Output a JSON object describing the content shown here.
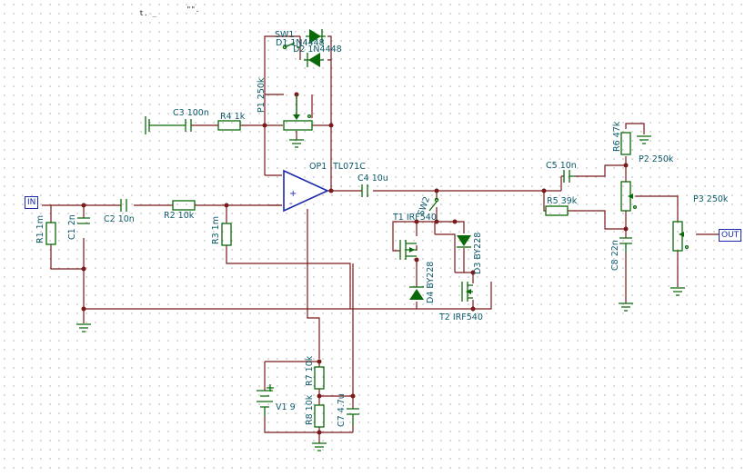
{
  "header": {
    "left": "t. _",
    "right": "\"\"."
  },
  "ports": {
    "input": "IN",
    "output": "OUT"
  },
  "labels": {
    "sw1": "SW1",
    "d1": "D1 1N4448",
    "d2": "D2 1N4448",
    "p1": "P1 250k",
    "c3": "C3 100n",
    "r4": "R4 1k",
    "op1": "OP1",
    "op1_model": "TL071C",
    "c4": "C4 10u",
    "c5": "C5 10n",
    "r6": "R6 47k",
    "p2": "P2 250k",
    "p3": "P3 250k",
    "r5": "R5 39k",
    "c8": "C8 22n",
    "r1": "R1 1m",
    "c1": "C1 2n",
    "c2": "C2 10n",
    "r2": "R2 10k",
    "r3": "R3 1m",
    "sw2": "SW2",
    "t1": "T1 IRF540",
    "t2": "T2 IRF540",
    "d3": "D3 BY228",
    "d4": "D4 BY228",
    "r7": "R7 10k",
    "r8": "R8 10k",
    "c7": "C7 4.7u",
    "v1": "V1 9",
    "plus": "+",
    "minus": "-"
  }
}
